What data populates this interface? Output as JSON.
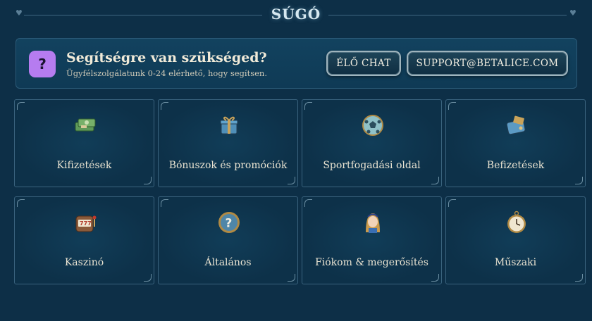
{
  "header": {
    "title": "SÚGÓ"
  },
  "help_banner": {
    "title": "Segítségre van szükséged?",
    "subtitle": "Ügyfélszolgálatunk 0-24 elérhető, hogy segítsen.",
    "icon": "question-icon",
    "icon_glyph": "?",
    "live_chat_label": "ÉLŐ CHAT",
    "support_email_label": "SUPPORT@BETALICE.COM"
  },
  "categories": [
    {
      "label": "Kifizetések",
      "icon": "money-stack-icon"
    },
    {
      "label": "Bónuszok és promóciók",
      "icon": "gift-box-icon"
    },
    {
      "label": "Sportfogadási oldal",
      "icon": "soccer-ball-icon"
    },
    {
      "label": "Befizetések",
      "icon": "wallet-icon"
    },
    {
      "label": "Kaszinó",
      "icon": "slot-machine-icon"
    },
    {
      "label": "Általános",
      "icon": "question-badge-icon"
    },
    {
      "label": "Fiókom & megerősítés",
      "icon": "alice-avatar-icon"
    },
    {
      "label": "Műszaki",
      "icon": "pocket-watch-icon"
    }
  ],
  "colors": {
    "background": "#0d2f47",
    "accent_purple": "#b67cf0",
    "text": "#eae4d2"
  }
}
